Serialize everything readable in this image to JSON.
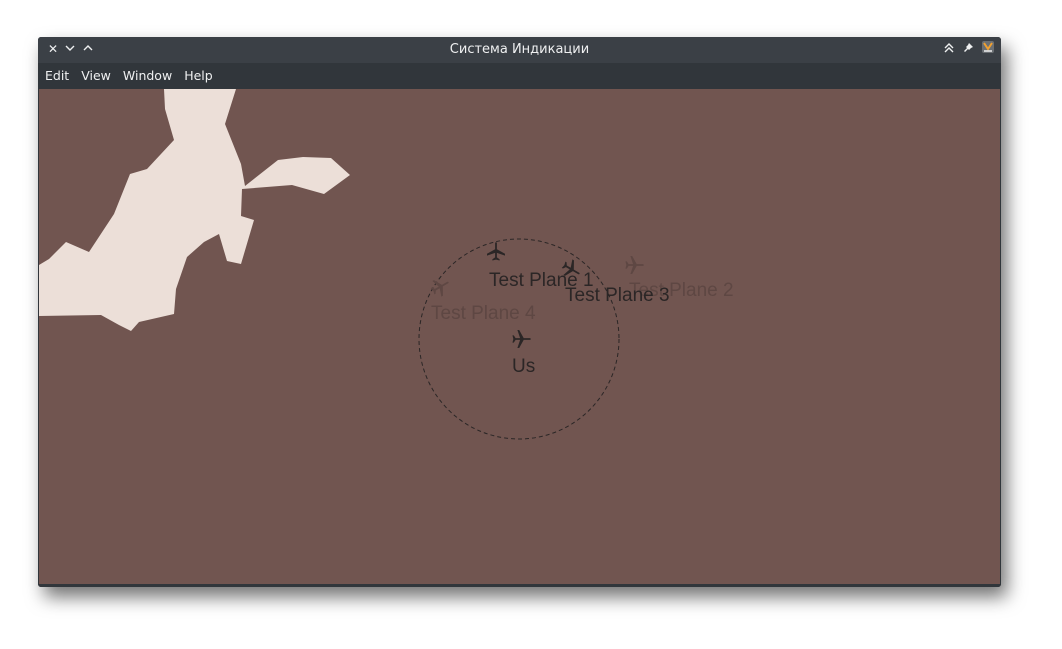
{
  "window": {
    "title": "Система Индикации",
    "controls_left": [
      "close-icon",
      "minimize-icon",
      "maximize-icon"
    ],
    "controls_right": [
      "keep-above-icon",
      "pin-icon",
      "app-icon"
    ]
  },
  "menu": {
    "items": [
      {
        "label": "Edit"
      },
      {
        "label": "View"
      },
      {
        "label": "Window"
      },
      {
        "label": "Help"
      }
    ]
  },
  "radar": {
    "background_color": "#715550",
    "land_color": "#ecdfd8",
    "range_ring": "dashed",
    "own_ship": {
      "label": "Us",
      "icon": "airplane-icon",
      "heading_deg": 90
    },
    "planes": [
      {
        "label": "Test Plane 1",
        "icon": "airplane-icon",
        "state": "active",
        "heading_deg": 0
      },
      {
        "label": "Test Plane 2",
        "icon": "airplane-icon",
        "state": "faded",
        "heading_deg": 90
      },
      {
        "label": "Test Plane 3",
        "icon": "airplane-icon",
        "state": "active",
        "heading_deg": 120
      },
      {
        "label": "Test Plane 4",
        "icon": "airplane-icon",
        "state": "faded",
        "heading_deg": 60
      }
    ],
    "colors": {
      "active": "#2b2626",
      "faded": "#5e4743",
      "ring": "#2b2626"
    }
  }
}
